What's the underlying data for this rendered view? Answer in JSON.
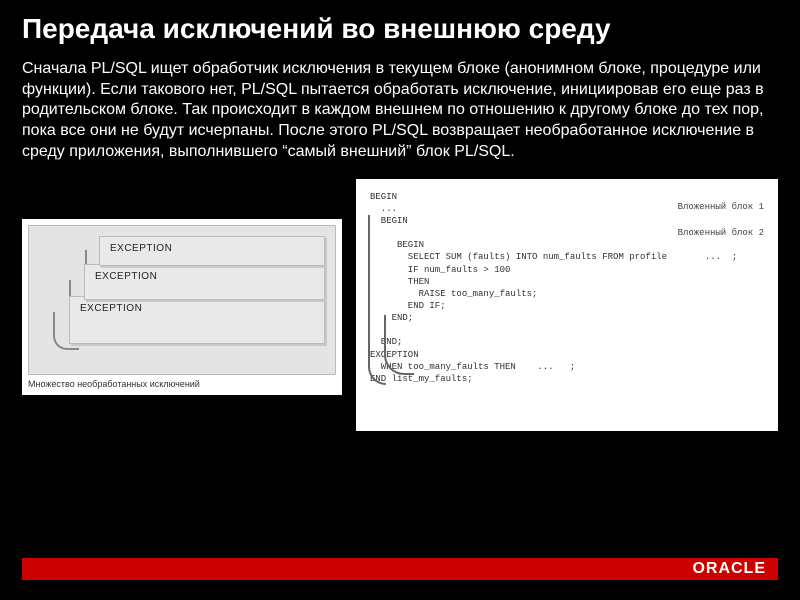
{
  "title": "Передача исключений во внешнюю среду",
  "body": "Сначала PL/SQL ищет обработчик исключения в текущем блоке (анонимном блоке, процедуре или функции). Если такового нет, PL/SQL пытается обработать исключение, инициировав его еще раз в родительском блоке. Так происходит в каждом внешнем по отношению к другому блоке до тех пор, пока все они не будут исчерпаны. После этого PL/SQL возвращает необработанное исключение в среду приложения, выполнившего “самый внешний” блок PL/SQL.",
  "left": {
    "label1": "EXCEPTION",
    "label2": "EXCEPTION",
    "label3": "EXCEPTION",
    "caption": "Множество необработанных исключений"
  },
  "right": {
    "tag1": "Вложенный блок 1",
    "tag2": "Вложенный блок 2",
    "lines": [
      "BEGIN",
      "  ...",
      "  BEGIN",
      "",
      "     BEGIN",
      "       SELECT SUM (faults) INTO num_faults FROM profile       ...  ;",
      "       IF num_faults > 100",
      "       THEN",
      "         RAISE too_many_faults;",
      "       END IF;",
      "    END;",
      "",
      "  END;",
      "EXCEPTION",
      "  WHEN too_many_faults THEN    ...   ;",
      "END list_my_faults;"
    ]
  },
  "brand": "ORACLE"
}
